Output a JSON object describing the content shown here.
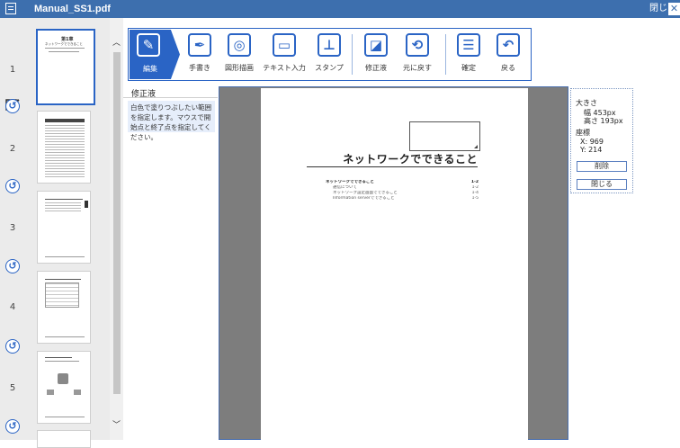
{
  "window": {
    "title": "Manual_SS1.pdf",
    "close_label": "閉じる",
    "close_glyph": "✕"
  },
  "sidebar": {
    "pages": [
      {
        "number": "1",
        "heading": "第1章",
        "subheading": "ネットワークでできること"
      },
      {
        "number": "2"
      },
      {
        "number": "3"
      },
      {
        "number": "4"
      },
      {
        "number": "5"
      }
    ],
    "rotate_glyph": "↺"
  },
  "toolbar": {
    "buttons": [
      {
        "label": "編集",
        "icon": "edit-icon",
        "glyph": "✎",
        "active": true
      },
      {
        "label": "手書き",
        "icon": "pen-icon",
        "glyph": "✒"
      },
      {
        "label": "図形描画",
        "icon": "shape-icon",
        "glyph": "◎"
      },
      {
        "label": "テキスト入力",
        "icon": "text-input-icon",
        "glyph": "▭"
      },
      {
        "label": "スタンプ",
        "icon": "stamp-icon",
        "glyph": "⊥"
      },
      {
        "label": "修正液",
        "icon": "eraser-icon",
        "glyph": "◪"
      },
      {
        "label": "元に戻す",
        "icon": "undo-document-icon",
        "glyph": "⟲"
      },
      {
        "label": "確定",
        "icon": "confirm-icon",
        "glyph": "☰"
      },
      {
        "label": "戻る",
        "icon": "back-icon",
        "glyph": "↶"
      }
    ]
  },
  "hint": {
    "title": "修正液",
    "text": "白色で塗りつぶしたい範囲を指定します。マウスで開始点と終了点を指定してください。"
  },
  "document": {
    "heading": "ネットワークでできること",
    "toc": [
      {
        "text": "ネットワークでできること",
        "page": "1-2",
        "main": true
      },
      {
        "text": "通信について",
        "page": "1-2"
      },
      {
        "text": "ネットワーク設定画面でできること",
        "page": "1-4"
      },
      {
        "text": "Information serverでできること",
        "page": "1-5"
      }
    ]
  },
  "info_panel": {
    "size_label": "大きさ",
    "width": "幅 453px",
    "height": "高さ 193px",
    "coords_label": "座標",
    "x": "X: 969",
    "y": "Y: 214",
    "delete_label": "削除",
    "close_label": "閉じる"
  },
  "colors": {
    "accent": "#2a64c5",
    "titlebar": "#3d6fae",
    "doc_bg": "#7d7d7d",
    "hint_bg": "#e6eefb"
  }
}
